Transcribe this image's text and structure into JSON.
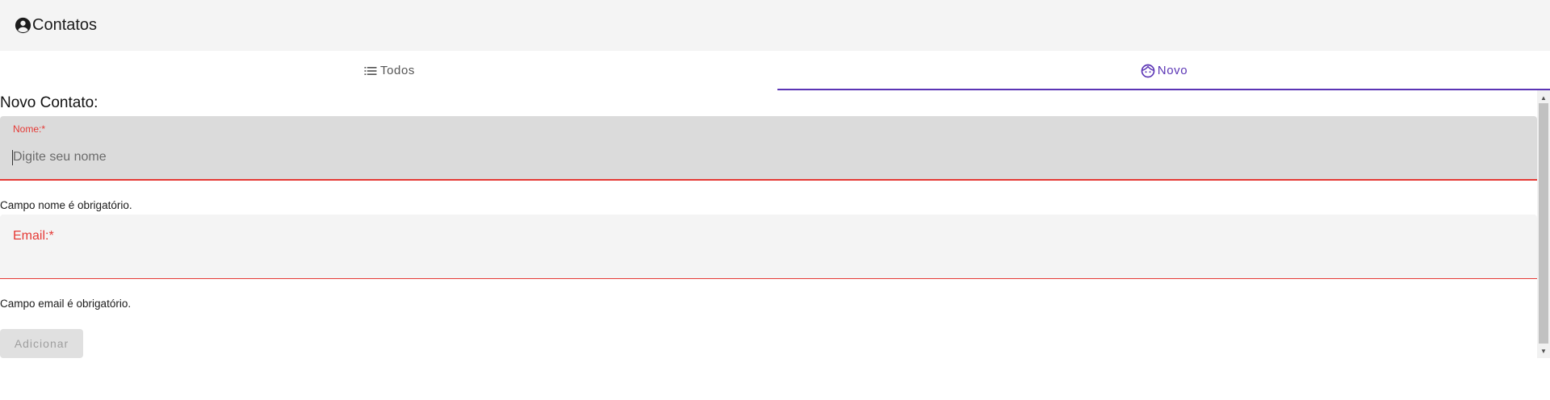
{
  "toolbar": {
    "title": "Contatos",
    "icon": "account-circle-icon"
  },
  "tabs": [
    {
      "label": "Todos",
      "icon": "list-icon",
      "active": false
    },
    {
      "label": "Novo",
      "icon": "face-icon",
      "active": true
    }
  ],
  "form": {
    "title": "Novo Contato:",
    "name": {
      "label": "Nome:*",
      "placeholder": "Digite seu nome",
      "value": "",
      "error": "Campo nome é obrigatório."
    },
    "email": {
      "label": "Email:*",
      "placeholder": "",
      "value": "",
      "error": "Campo email é obrigatório."
    },
    "submit_label": "Adicionar"
  },
  "scrollbar": {
    "up_arrow": "▲",
    "down_arrow": "▼"
  },
  "colors": {
    "accent": "#5b35b5",
    "error": "#e53935",
    "toolbar_bg": "#f4f4f4",
    "disabled_button": "#e0e0e0"
  }
}
